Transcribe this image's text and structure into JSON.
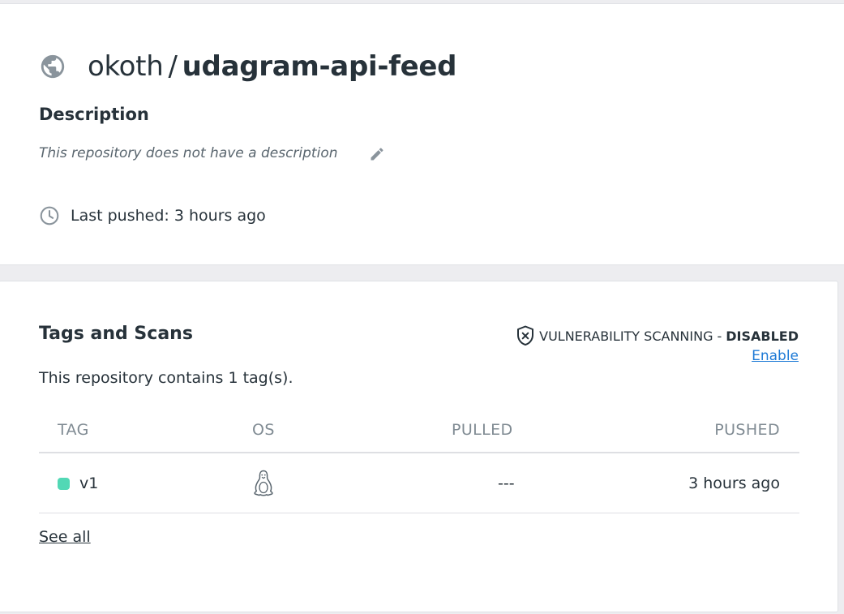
{
  "repo": {
    "namespace": "okoth",
    "separator": "/",
    "name": "udagram-api-feed",
    "icon": "globe-icon"
  },
  "description": {
    "heading": "Description",
    "text": "This repository does not have a description",
    "edit_icon": "pencil-icon"
  },
  "last_pushed": {
    "icon": "clock-icon",
    "text": "Last pushed: 3 hours ago"
  },
  "tags": {
    "heading": "Tags and Scans",
    "scanning": {
      "icon": "shield-x-icon",
      "label": "VULNERABILITY SCANNING",
      "dash": "-",
      "status": "DISABLED",
      "status_color": "#27323a",
      "enable_label": "Enable",
      "link_color": "#1e7ad6"
    },
    "count_text": "This repository contains 1 tag(s).",
    "columns": {
      "tag": "TAG",
      "os": "OS",
      "pulled": "PULLED",
      "pushed": "PUSHED"
    },
    "rows": [
      {
        "tag": "v1",
        "status_color": "#52d8b5",
        "os_icon": "linux-tux-icon",
        "pulled": "---",
        "pushed": "3 hours ago"
      }
    ],
    "see_all": "See all"
  }
}
